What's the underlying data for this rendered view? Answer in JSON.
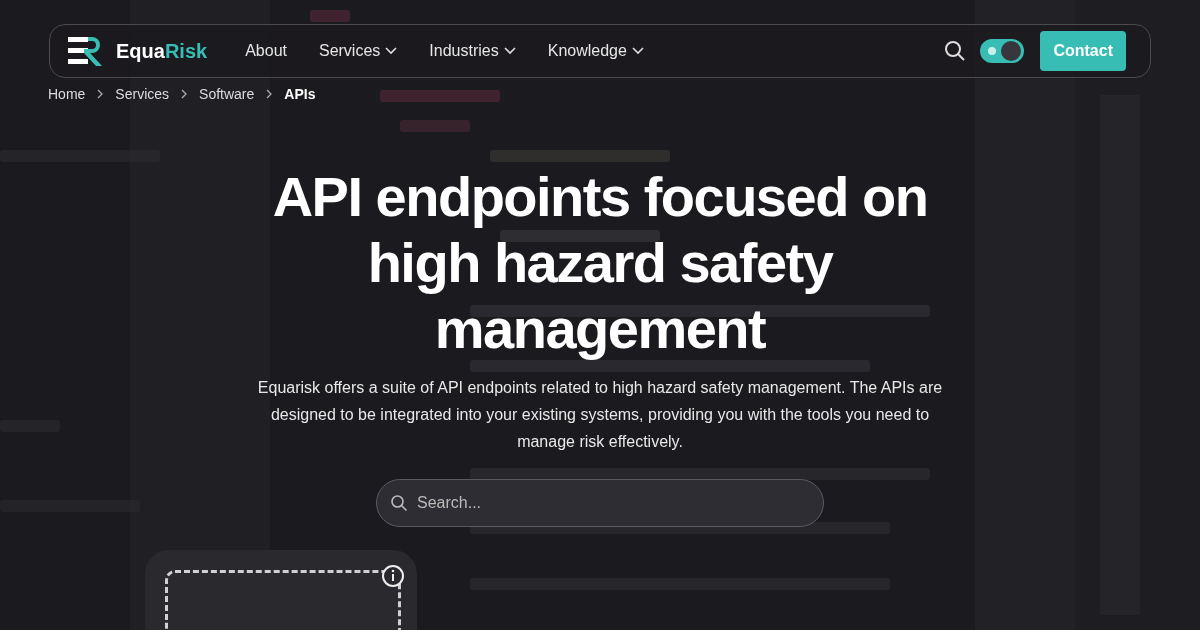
{
  "nav": {
    "brand": {
      "first": "Equa",
      "second": "Risk"
    },
    "links": [
      {
        "label": "About",
        "dropdown": false
      },
      {
        "label": "Services",
        "dropdown": true
      },
      {
        "label": "Industries",
        "dropdown": true
      },
      {
        "label": "Knowledge",
        "dropdown": true
      }
    ],
    "theme_toggle": {
      "on": true
    },
    "contact": "Contact"
  },
  "breadcrumb": [
    {
      "label": "Home",
      "current": false
    },
    {
      "label": "Services",
      "current": false
    },
    {
      "label": "Software",
      "current": false
    },
    {
      "label": "APIs",
      "current": true
    }
  ],
  "hero": {
    "title": "API endpoints focused on high hazard safety management",
    "description": "Equarisk offers a suite of API endpoints related to high hazard safety management. The APIs are designed to be integrated into your existing systems, providing you with the tools you need to manage risk effectively.",
    "search": {
      "placeholder": "Search..."
    }
  },
  "cards": [
    {
      "kind": "placeholder"
    }
  ]
}
